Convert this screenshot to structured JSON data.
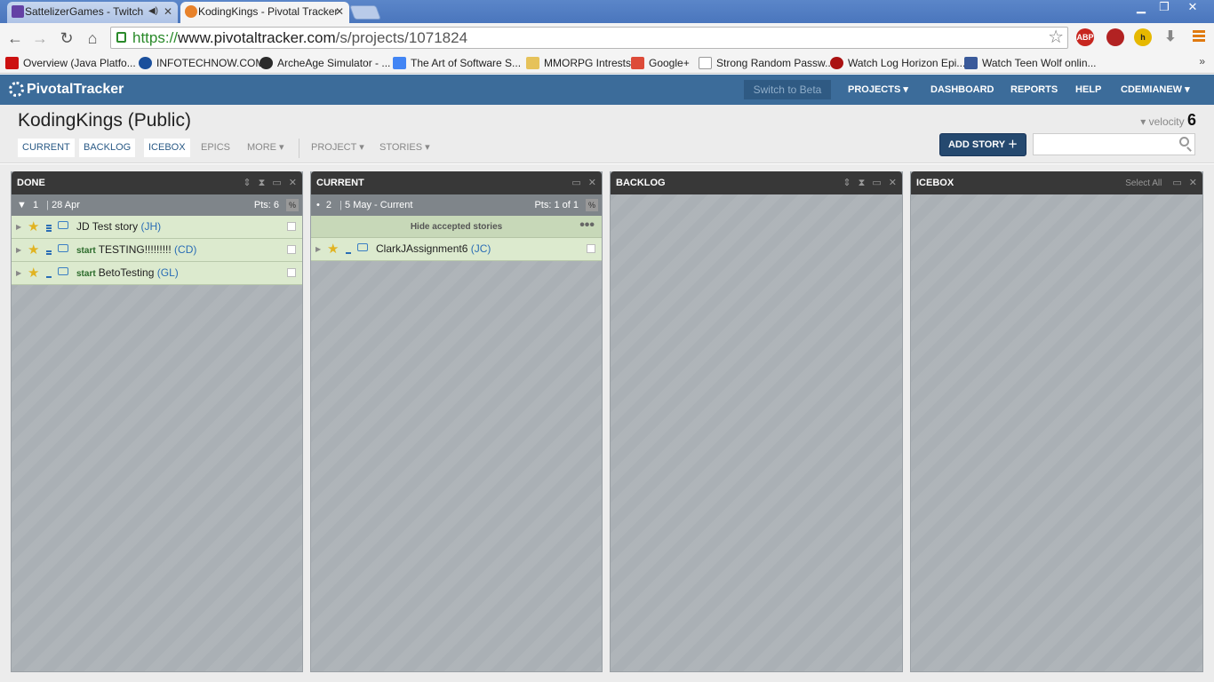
{
  "browser": {
    "tabs": [
      {
        "title": "SattelizerGames - Twitch",
        "favicon_color": "#6441a5",
        "active": false
      },
      {
        "title": "KodingKings - Pivotal Tracker",
        "favicon_color": "#e8822a",
        "active": true
      }
    ],
    "url": {
      "scheme": "https://",
      "host": "www.pivotaltracker.com",
      "path": "/s/projects/1071824"
    },
    "bookmarks": [
      {
        "label": "Overview (Java Platfo...",
        "icon_color": "#cc1111"
      },
      {
        "label": "INFOTECHNOW.COM",
        "icon_color": "#1a4f9c"
      },
      {
        "label": "ArcheAge Simulator - ...",
        "icon_color": "#2b2b2b"
      },
      {
        "label": "The Art of Software S...",
        "icon_color": "#4285f4"
      },
      {
        "label": "MMORPG Intrests",
        "icon_color": "#e6c25a"
      },
      {
        "label": "Google+",
        "icon_color": "#dd4b39"
      },
      {
        "label": "Strong Random Passw...",
        "icon_color": "#eeeeee"
      },
      {
        "label": "Watch Log Horizon Epi...",
        "icon_color": "#aa1111"
      },
      {
        "label": "Watch Teen Wolf onlin...",
        "icon_color": "#3a5a9a"
      }
    ],
    "extensions": [
      {
        "name": "adblock-icon",
        "label": "ABP",
        "color": "#c7261f"
      },
      {
        "name": "ublock-icon",
        "label": "",
        "color": "#b22222"
      },
      {
        "name": "hola-icon",
        "label": "h",
        "color": "#e6b800"
      },
      {
        "name": "download-icon",
        "label": "",
        "color": "#888888"
      }
    ]
  },
  "pt": {
    "logo": "PivotalTracker",
    "switch_beta": "Switch to Beta",
    "nav": [
      "PROJECTS",
      "DASHBOARD",
      "REPORTS",
      "HELP",
      "CDEMIANEW"
    ]
  },
  "project": {
    "title": "KodingKings (Public)",
    "tabs": [
      "CURRENT",
      "BACKLOG",
      "ICEBOX",
      "EPICS",
      "MORE"
    ],
    "menus": [
      "PROJECT",
      "STORIES"
    ],
    "velocity_label": "velocity",
    "velocity_value": "6",
    "add_story": "ADD STORY",
    "search_placeholder": ""
  },
  "panels": {
    "done": {
      "title": "DONE",
      "iteration_num": "1",
      "iteration_date": "28 Apr",
      "pts": "Pts: 6",
      "pct": "%",
      "stories": [
        {
          "prefix": "",
          "text": "JD Test story",
          "owner": "(JH)",
          "estimate": 3
        },
        {
          "prefix": "start",
          "text": "TESTING!!!!!!!!!",
          "owner": "(CD)",
          "estimate": 2
        },
        {
          "prefix": "start",
          "text": "BetoTesting",
          "owner": "(GL)",
          "estimate": 1
        }
      ]
    },
    "current": {
      "title": "CURRENT",
      "iteration_num": "2",
      "iteration_date": "5 May - Current",
      "pts": "Pts: 1 of 1",
      "pct": "%",
      "hide_accepted": "Hide accepted stories",
      "stories": [
        {
          "prefix": "",
          "text": "ClarkJAssignment6",
          "owner": "(JC)",
          "estimate": 1
        }
      ]
    },
    "backlog": {
      "title": "BACKLOG"
    },
    "icebox": {
      "title": "ICEBOX",
      "select_all": "Select All"
    }
  }
}
